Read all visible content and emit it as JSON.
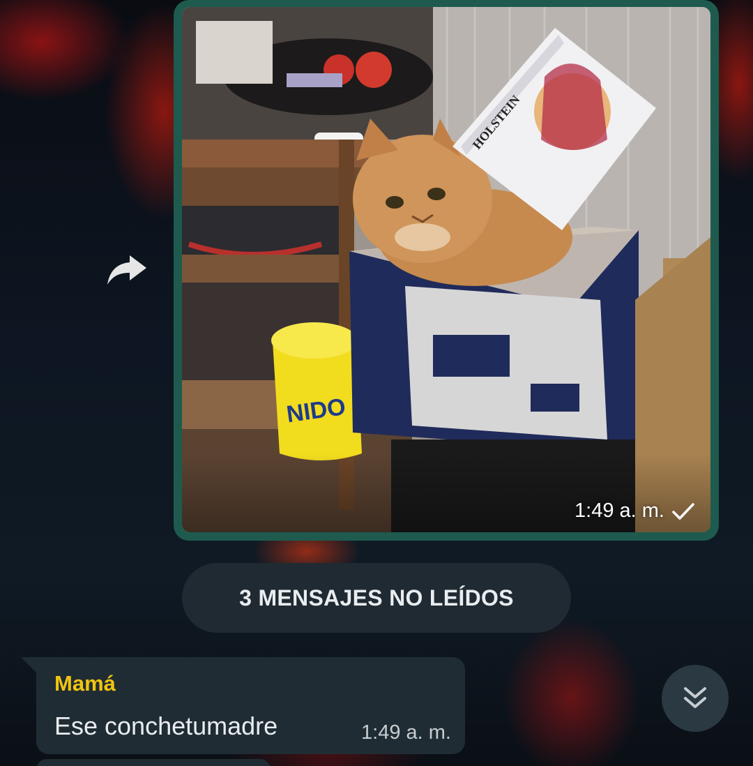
{
  "colors": {
    "image_bubble_border": "#1e5b4e",
    "incoming_bubble": "#202c33",
    "unread_pill": "#1f2a33",
    "sender_name": "#f1c40f",
    "text_primary": "#e9edef"
  },
  "forward_button": {
    "icon": "forward-arrow-icon"
  },
  "image_message": {
    "image_description_icon": "photo-cat-in-box",
    "time": "1:49 a. m.",
    "status_icon": "single-check-icon"
  },
  "unread_divider": {
    "label": "3 MENSAJES NO LEÍDOS"
  },
  "incoming_message": {
    "sender": "Mamá",
    "text": "Ese conchetumadre",
    "time": "1:49 a. m."
  },
  "scroll_button": {
    "icon": "double-chevron-down-icon"
  }
}
